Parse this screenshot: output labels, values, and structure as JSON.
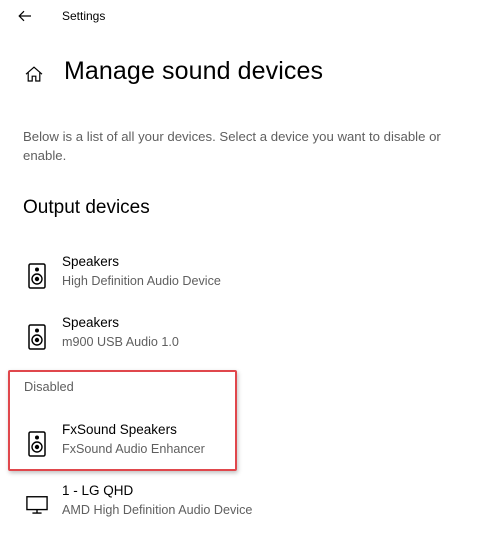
{
  "window": {
    "title": "Settings"
  },
  "page": {
    "title": "Manage sound devices",
    "description": "Below is a list of all your devices. Select a device you want to disable or enable."
  },
  "output_devices": {
    "heading": "Output devices",
    "items": [
      {
        "name": "Speakers",
        "subtitle": "High Definition Audio Device",
        "icon": "speaker-icon"
      },
      {
        "name": "Speakers",
        "subtitle": "m900 USB Audio 1.0",
        "icon": "speaker-icon"
      }
    ]
  },
  "disabled": {
    "label": "Disabled",
    "items": [
      {
        "name": "FxSound Speakers",
        "subtitle": "FxSound Audio Enhancer",
        "icon": "speaker-icon"
      },
      {
        "name": "1 - LG QHD",
        "subtitle": "AMD High Definition Audio Device",
        "icon": "monitor-icon"
      }
    ]
  },
  "colors": {
    "highlight_border": "#e0474c",
    "secondary_text": "#5f5f5f"
  }
}
